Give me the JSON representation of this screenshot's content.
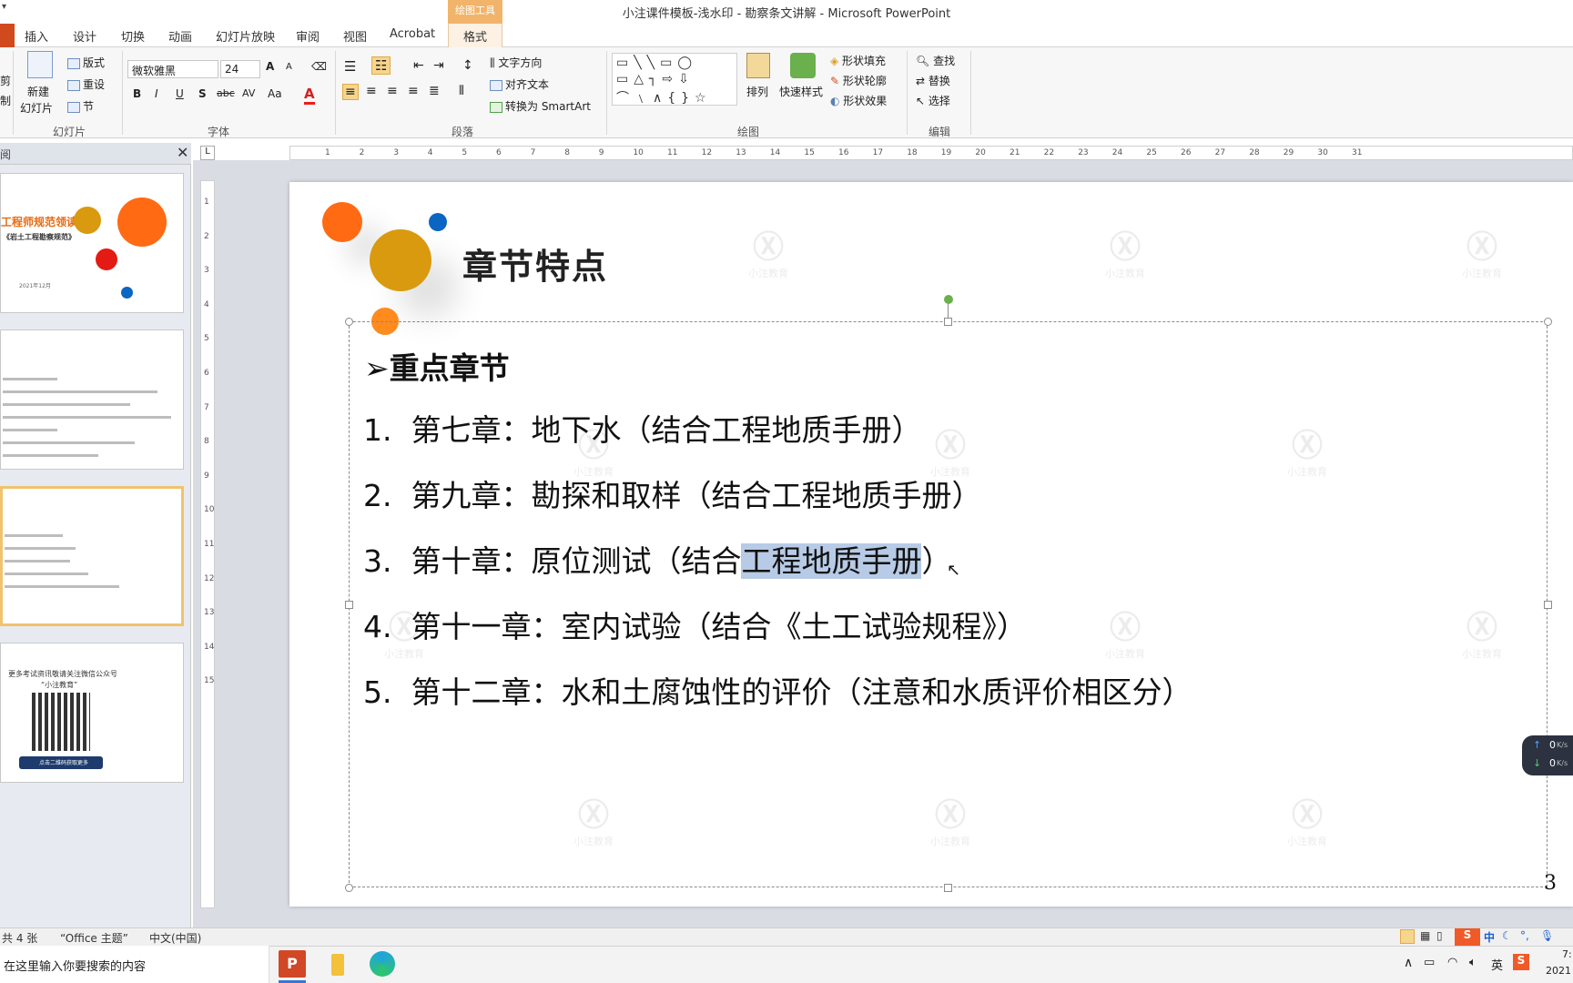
{
  "window": {
    "title": "小注课件模板-浅水印 - 勘察条文讲解 - Microsoft PowerPoint",
    "context_group": "绘图工具"
  },
  "tabs": [
    {
      "label": "插入"
    },
    {
      "label": "设计"
    },
    {
      "label": "切换"
    },
    {
      "label": "动画"
    },
    {
      "label": "幻灯片放映"
    },
    {
      "label": "审阅"
    },
    {
      "label": "视图"
    },
    {
      "label": "Acrobat"
    },
    {
      "label": "格式"
    }
  ],
  "ribbon": {
    "slides": {
      "new_slide": "新建",
      "new_slide2": "幻灯片",
      "layout": "版式",
      "reset": "重设",
      "section": "节",
      "group": "幻灯片",
      "cut_label": "剪",
      "clip_label": "制"
    },
    "font": {
      "name": "微软雅黑",
      "size": "24",
      "grow": "A",
      "shrink": "A",
      "group": "字体",
      "bold": "B",
      "italic": "I",
      "underline": "U",
      "shadow": "S",
      "strike": "abc",
      "spacing": "AV",
      "case": "Aa",
      "color": "A"
    },
    "paragraph": {
      "text_dir": "文字方向",
      "align_text": "对齐文本",
      "smartart": "转换为 SmartArt",
      "group": "段落"
    },
    "drawing": {
      "arrange": "排列",
      "quick_styles": "快速样式",
      "fill": "形状填充",
      "outline": "形状轮廓",
      "effects": "形状效果",
      "group": "绘图"
    },
    "editing": {
      "find": "查找",
      "replace": "替换",
      "select": "选择",
      "group": "编辑"
    }
  },
  "thumbnails": {
    "pane_label": "阅",
    "s1": {
      "title": "工程师规范领读",
      "subtitle": "《岩土工程勘察规范》",
      "date": "2021年12月"
    },
    "s4": {
      "line1": "更多考试资讯敬请关注微信公众号",
      "line2": "“小注教育”",
      "button": "点击二维码获取更多"
    }
  },
  "slide": {
    "title": "章节特点",
    "bullet_heading": "➢重点章节",
    "items": [
      {
        "num": "1.",
        "text": "第七章：地下水（结合工程地质手册）"
      },
      {
        "num": "2.",
        "text": "第九章：勘探和取样（结合工程地质手册）"
      },
      {
        "num": "3.",
        "pre": "第十章：原位测试（结合",
        "sel": "工程地质手册",
        "post": "）"
      },
      {
        "num": "4.",
        "text": "第十一章：室内试验（结合《土工试验规程》）"
      },
      {
        "num": "5.",
        "text": "第十二章：水和土腐蚀性的评价（注意和水质评价相区分）"
      }
    ],
    "slide_number": "3",
    "watermark_text": "小注教育"
  },
  "ruler_h_numbers": [
    "1",
    "2",
    "3",
    "4",
    "5",
    "6",
    "7",
    "8",
    "9",
    "10",
    "11",
    "12",
    "13",
    "14",
    "15",
    "16",
    "17",
    "18",
    "19",
    "20",
    "21",
    "22",
    "23",
    "24",
    "25",
    "26",
    "27",
    "28",
    "29",
    "30",
    "31"
  ],
  "ruler_v_numbers": [
    "1",
    "2",
    "3",
    "4",
    "5",
    "6",
    "7",
    "8",
    "9",
    "10",
    "11",
    "12",
    "13",
    "14",
    "15"
  ],
  "netspeed": {
    "up": "0",
    "down": "0",
    "unit": "K/s"
  },
  "statusbar": {
    "slide_count": "共 4 张",
    "theme": "“Office 主题”",
    "language": "中文(中国)"
  },
  "taskbar": {
    "search_placeholder": "在这里输入你要搜索的内容",
    "ime": "中",
    "clock_partial": "7:",
    "date_partial": "2021"
  },
  "colors": {
    "accent_orange": "#ff6a13",
    "gold": "#d99a0f",
    "blue": "#0a66c2",
    "red": "#e31b14",
    "selection": "#b7cbe6"
  }
}
